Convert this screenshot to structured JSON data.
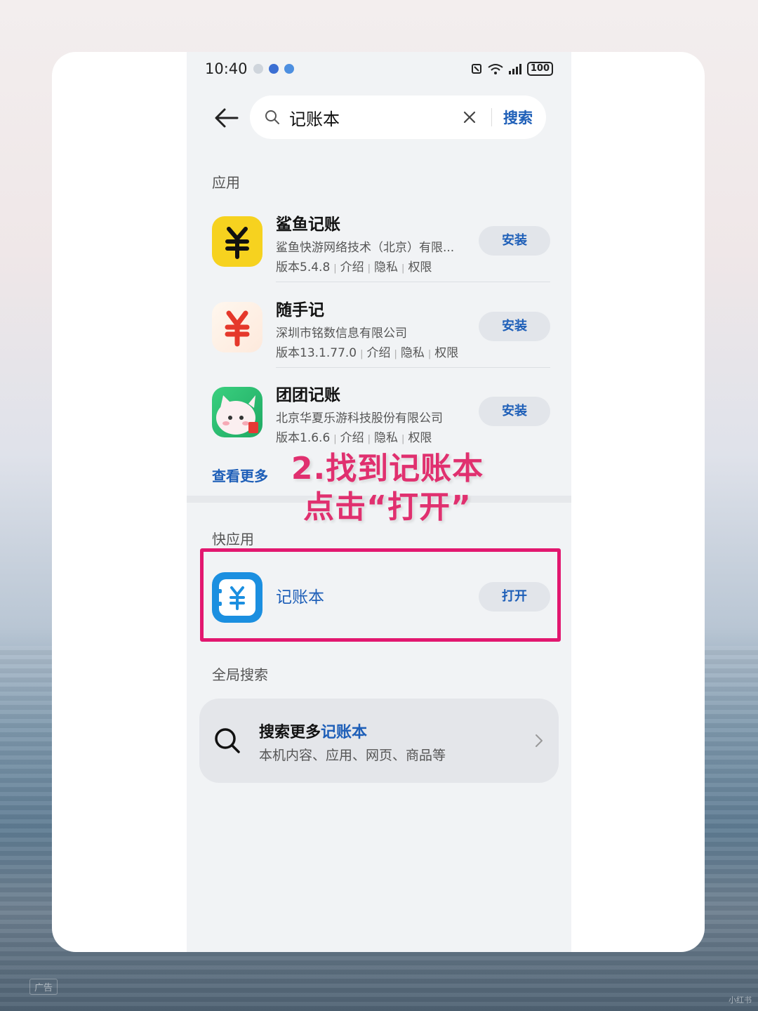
{
  "status_bar": {
    "time": "10:40",
    "battery": "100"
  },
  "search": {
    "query": "记账本",
    "button_label": "搜索"
  },
  "sections": {
    "apps_title": "应用",
    "quick_apps_title": "快应用",
    "global_title": "全局搜索"
  },
  "apps": [
    {
      "name": "鲨鱼记账",
      "developer": "鲨鱼快游网络技术（北京）有限...",
      "version": "版本5.4.8",
      "intro": "介绍",
      "privacy": "隐私",
      "perms": "权限",
      "action": "安装"
    },
    {
      "name": "随手记",
      "developer": "深圳市铭数信息有限公司",
      "version": "版本13.1.77.0",
      "intro": "介绍",
      "privacy": "隐私",
      "perms": "权限",
      "action": "安装"
    },
    {
      "name": "团团记账",
      "developer": "北京华夏乐游科技股份有限公司",
      "version": "版本1.6.6",
      "intro": "介绍",
      "privacy": "隐私",
      "perms": "权限",
      "action": "安装"
    }
  ],
  "see_more": "查看更多",
  "quick_app": {
    "name": "记账本",
    "action": "打开"
  },
  "global_search": {
    "title_prefix": "搜索更多",
    "title_query": "记账本",
    "subtitle": "本机内容、应用、网页、商品等"
  },
  "annotation": {
    "line1": "2.找到记账本",
    "line2": "点击“打开”"
  },
  "ad_label": "广告",
  "watermark": "小红书",
  "colors": {
    "accent_blue": "#1e5fb8",
    "highlight_pink": "#e2176f",
    "annotation_pink": "#e0306f"
  }
}
